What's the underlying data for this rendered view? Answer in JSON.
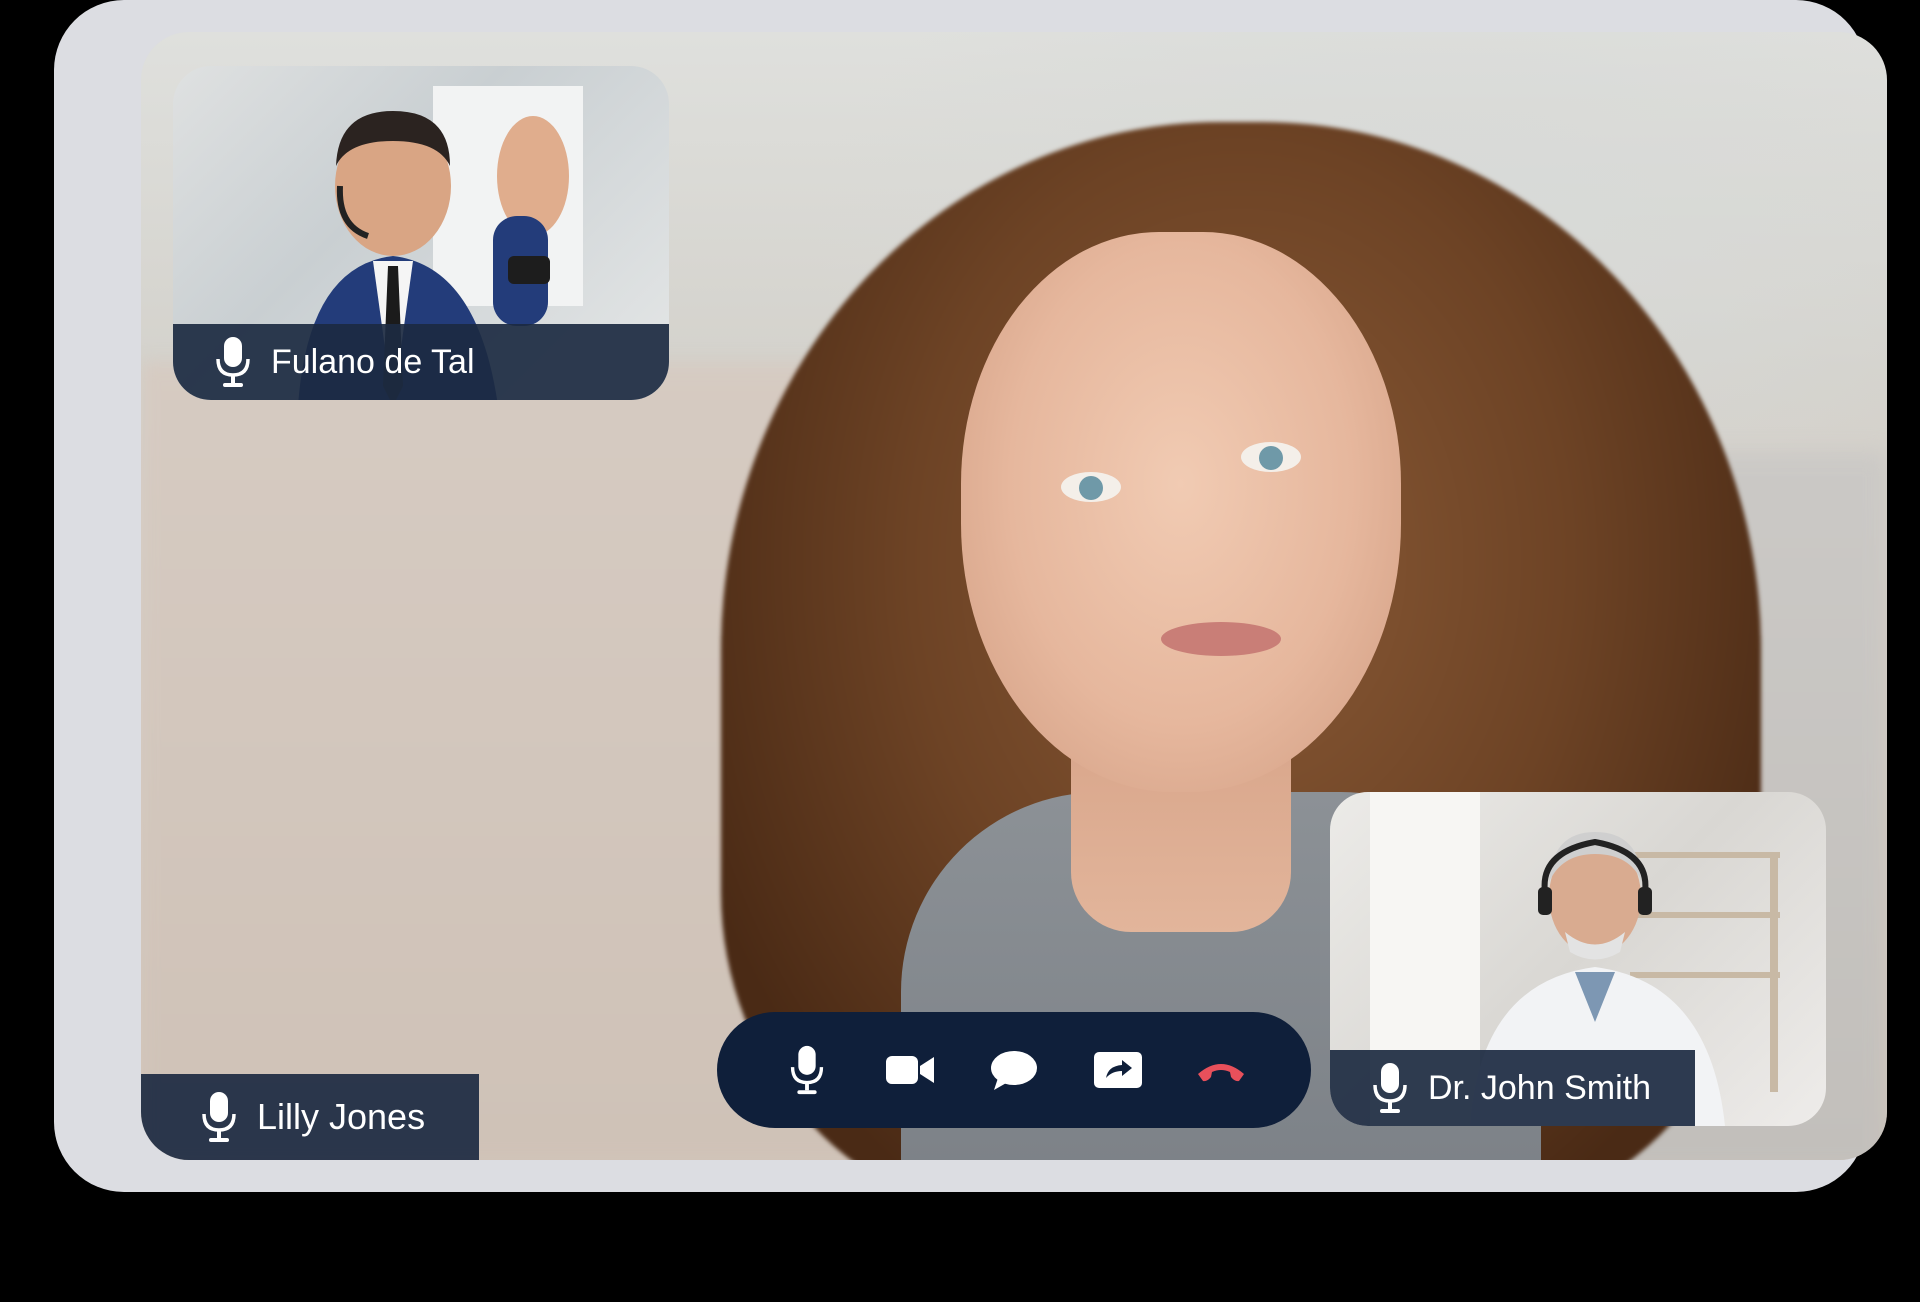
{
  "main_participant": {
    "name": "Lilly Jones"
  },
  "participants": [
    {
      "name": "Fulano de Tal"
    },
    {
      "name": "Dr. John Smith"
    }
  ],
  "controls": {
    "items": [
      "mic",
      "camera",
      "chat",
      "share",
      "end-call"
    ]
  },
  "colors": {
    "frame": "#dcdde2",
    "label_bg": "#1c2a41",
    "control_bar": "#0f1f3a",
    "end_call": "#e8505b",
    "icon": "#ffffff"
  }
}
